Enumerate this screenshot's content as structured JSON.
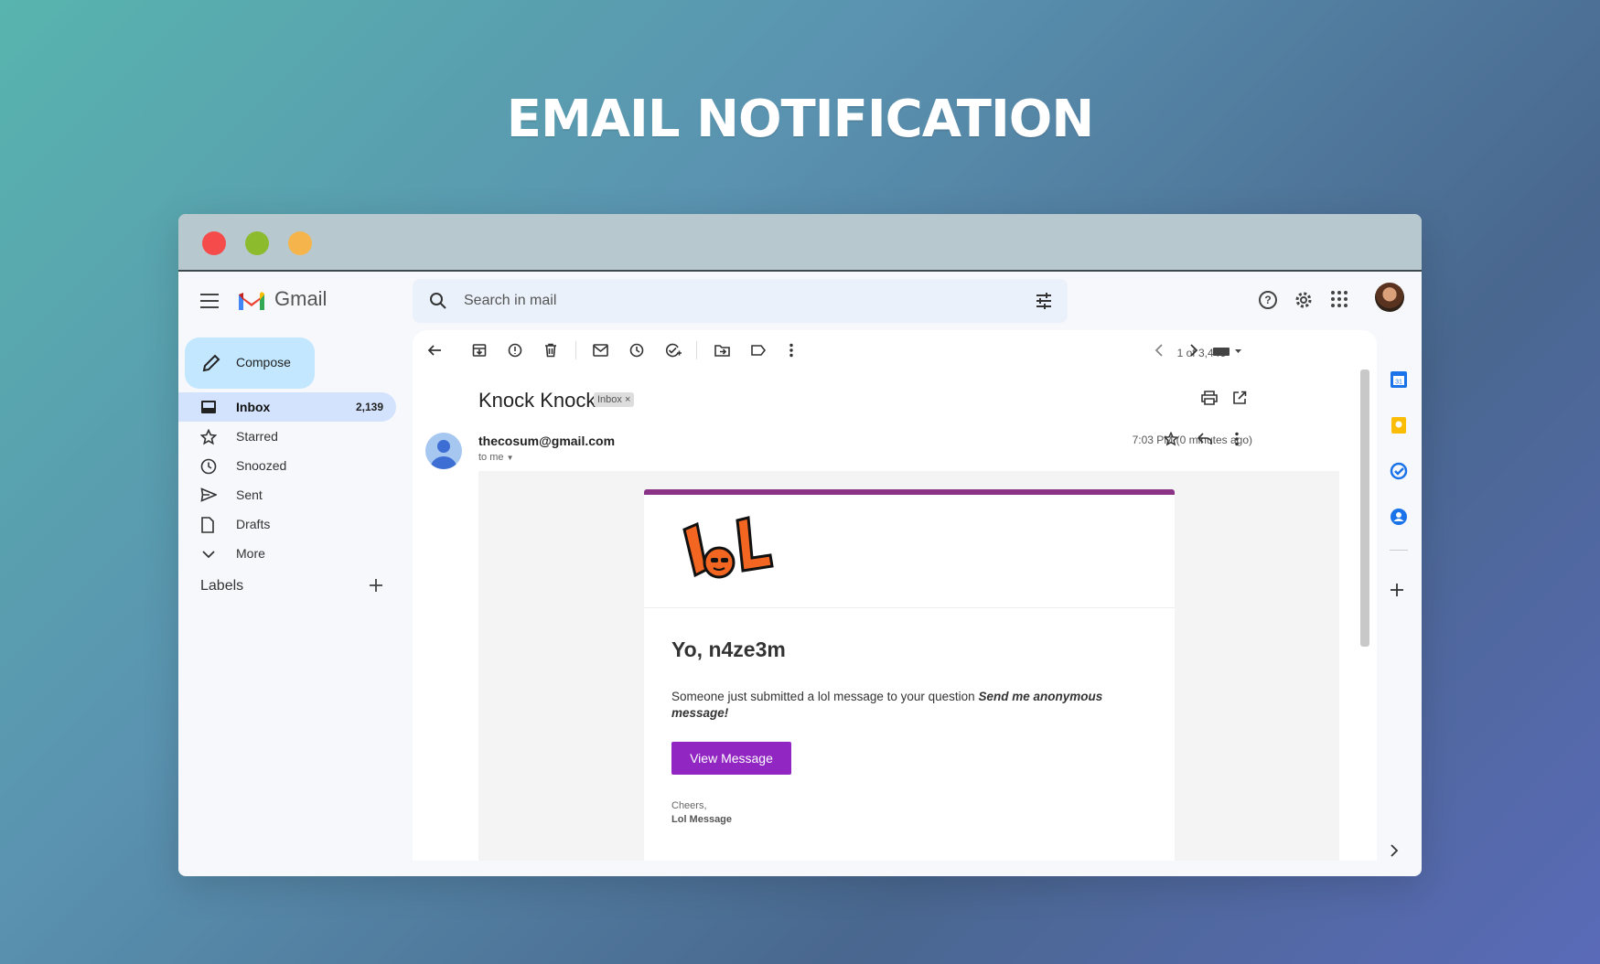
{
  "banner": {
    "title": "EMAIL NOTIFICATION"
  },
  "app": {
    "name": "Gmail"
  },
  "search": {
    "placeholder": "Search in mail"
  },
  "compose": {
    "label": "Compose"
  },
  "sidebar": {
    "items": [
      {
        "label": "Inbox",
        "count": "2,139",
        "icon": "inbox-icon"
      },
      {
        "label": "Starred",
        "icon": "star-icon"
      },
      {
        "label": "Snoozed",
        "icon": "clock-icon"
      },
      {
        "label": "Sent",
        "icon": "send-icon"
      },
      {
        "label": "Drafts",
        "icon": "draft-icon"
      },
      {
        "label": "More",
        "icon": "chevron-down-icon"
      }
    ],
    "labels_heading": "Labels"
  },
  "toolbar": {
    "pager": "1 of 3,446"
  },
  "email": {
    "subject": "Knock Knock",
    "badge": "Inbox",
    "sender": "thecosum@gmail.com",
    "to": "to me",
    "time": "7:03 PM (0 minutes ago)",
    "body": {
      "greeting": "Yo, n4ze3m",
      "text": "Someone just submitted a lol message to your question ",
      "question": "Send me anonymous message!",
      "button": "View Message",
      "signoff": "Cheers,",
      "signature": "Lol Message"
    }
  },
  "colors": {
    "accent": "#8b3487",
    "button": "#9126c2",
    "compose": "#c2e7ff"
  }
}
